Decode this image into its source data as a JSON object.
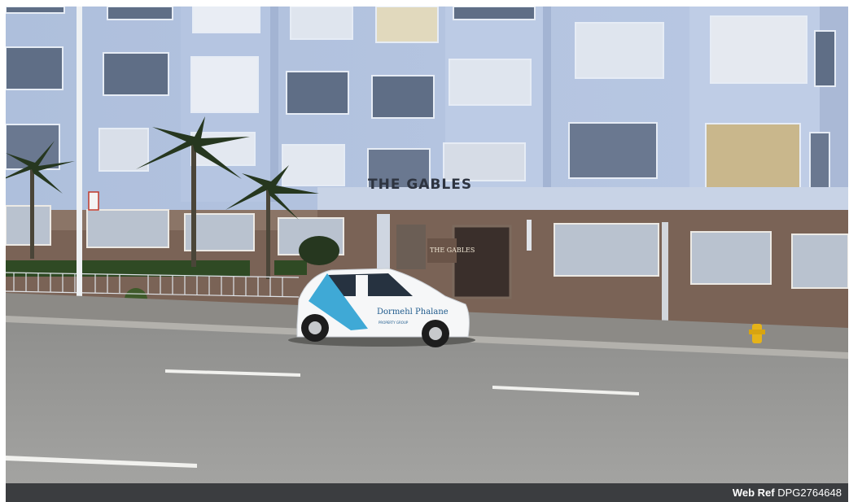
{
  "photo": {
    "building_sign": "THE GABLES",
    "entrance_sign": "THE GABLES",
    "car_brand": "Dormehl Phalane",
    "car_tagline": "PROPERTY GROUP"
  },
  "footer": {
    "web_ref_label": "Web Ref",
    "web_ref_value": "DPG2764648"
  }
}
